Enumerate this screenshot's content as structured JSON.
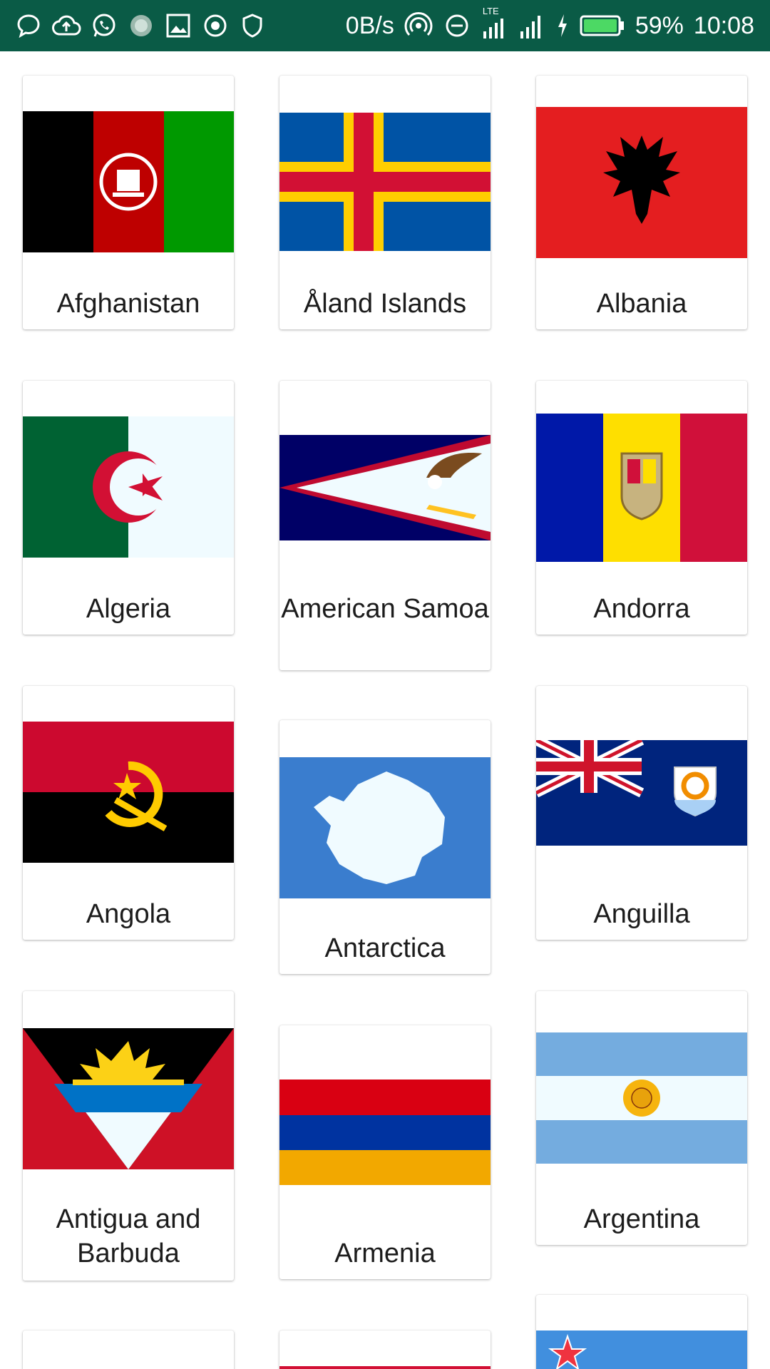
{
  "status_bar": {
    "network_speed": "0B/s",
    "network_type": "LTE",
    "battery_percent": "59%",
    "time": "10:08",
    "left_icons": [
      "chat-bubble-icon",
      "cloud-upload-icon",
      "whatsapp-icon",
      "loading-icon",
      "image-icon",
      "target-icon",
      "shield-icon"
    ],
    "right_icons": [
      "hotspot-icon",
      "dnd-icon",
      "signal-lte-icon",
      "signal-icon",
      "charging-icon",
      "battery-icon"
    ]
  },
  "countries": [
    {
      "name": "Afghanistan",
      "flag": "afghanistan-flag"
    },
    {
      "name": "Åland Islands",
      "flag": "aland-islands-flag"
    },
    {
      "name": "Albania",
      "flag": "albania-flag"
    },
    {
      "name": "Algeria",
      "flag": "algeria-flag"
    },
    {
      "name": "American Samoa",
      "flag": "american-samoa-flag"
    },
    {
      "name": "Andorra",
      "flag": "andorra-flag"
    },
    {
      "name": "Angola",
      "flag": "angola-flag"
    },
    {
      "name": "Antarctica",
      "flag": "antarctica-flag"
    },
    {
      "name": "Anguilla",
      "flag": "anguilla-flag"
    },
    {
      "name": "Antigua and Barbuda",
      "flag": "antigua-and-barbuda-flag"
    },
    {
      "name": "Armenia",
      "flag": "armenia-flag"
    },
    {
      "name": "Argentina",
      "flag": "argentina-flag"
    },
    {
      "name": "",
      "flag": "partial-card"
    },
    {
      "name": "",
      "flag": "partial-red-flag"
    },
    {
      "name": "",
      "flag": "partial-blue-star-flag"
    }
  ]
}
